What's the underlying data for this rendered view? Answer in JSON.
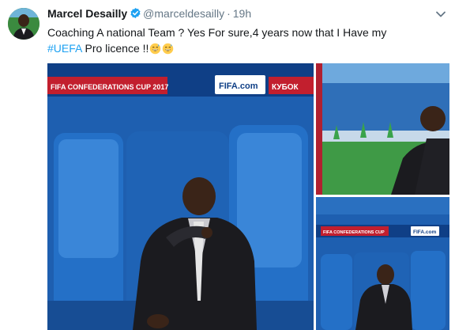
{
  "tweet": {
    "author_name": "Marcel Desailly",
    "handle": "@marceldesailly",
    "separator": "·",
    "time": "19h",
    "text_line1": "Coaching A national Team ?  Yes For sure,4 years now that I Have my",
    "hashtag": "#UEFA",
    "text_line2_after": " Pro licence !!"
  },
  "media": {
    "banner_left": "FIFA CONFEDERATIONS CUP 2017",
    "banner_logo": "FIFA.com",
    "banner_right": "КУБОК",
    "small_banner_left": "FIFA CONFEDERATIONS CUP",
    "small_banner_logo": "FIFA.com"
  },
  "icons": {
    "verified": "verified-badge-icon",
    "chevron": "chevron-down-icon",
    "emoji": "grinning-sweat-emoji"
  },
  "colors": {
    "hashtag": "#1da1f2",
    "verified": "#1da1f2",
    "muted": "#657786",
    "seat_blue": "#1f63b5",
    "wall_blue": "#1e5fb0",
    "banner_red": "#c21f2e"
  }
}
